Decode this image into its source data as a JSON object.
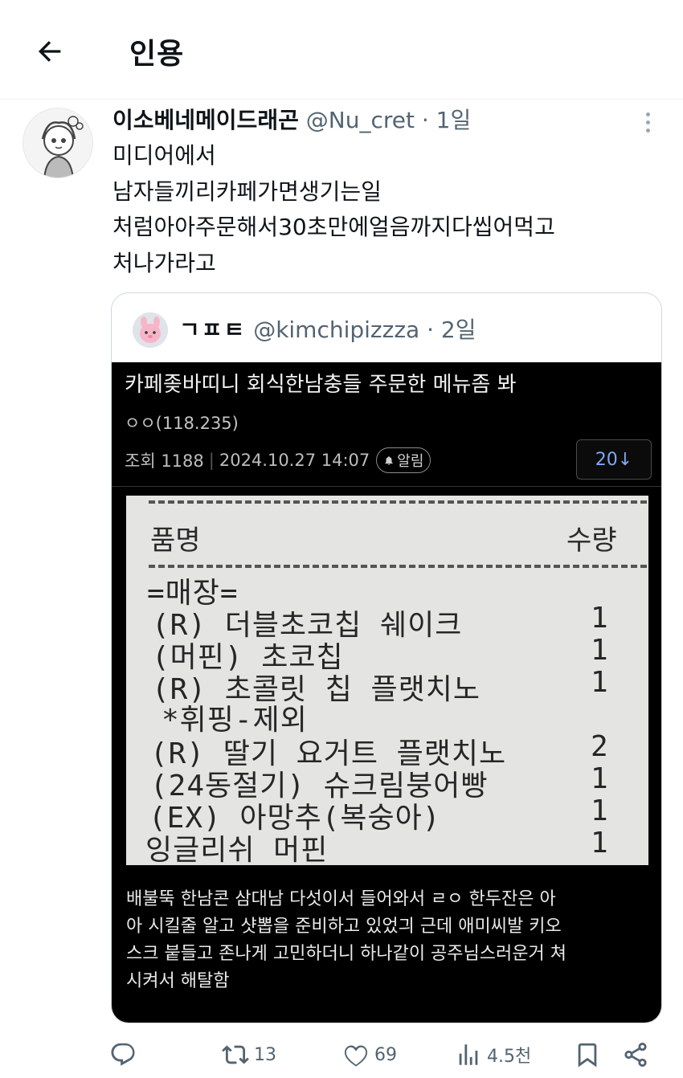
{
  "header": {
    "title": "인용"
  },
  "tweet": {
    "author_name": "이소베네메이드래곤",
    "handle": "@Nu_cret",
    "time": "1일",
    "lines": [
      "미디어에서",
      "남자들끼리카페가면생기는일",
      "처럼아아주문해서30초만에얼음까지다씹어먹고",
      "처나가라고"
    ]
  },
  "quote": {
    "author_name": "ㄱㅍㅌ",
    "handle": "@kimchipizzza",
    "time": "2일",
    "post": {
      "title": "카페좆바띠니 회식한남충들 주문한 메뉴좀 봐",
      "author": "ㅇㅇ(118.235)",
      "views_label": "조회 1188",
      "date": "2024.10.27 14:07",
      "alarm": "알림",
      "page_button": "20↓"
    },
    "receipt": {
      "col_item": "품명",
      "col_qty": "수량",
      "section": "=매장=",
      "items": [
        {
          "name": "(R) 더블초코칩 쉐이크",
          "qty": "1"
        },
        {
          "name": "(머핀) 초코칩",
          "qty": "1"
        },
        {
          "name": "(R) 초콜릿 칩 플랫치노",
          "qty": "1"
        },
        {
          "name": " *휘핑-제외",
          "qty": ""
        },
        {
          "name": "(R) 딸기 요거트 플랫치노",
          "qty": "2"
        },
        {
          "name": "(24동절기) 슈크림붕어빵",
          "qty": "1"
        },
        {
          "name": "(EX) 아망추(복숭아)",
          "qty": "1"
        },
        {
          "name": "잉글리쉬 머핀",
          "qty": "1"
        }
      ]
    },
    "caption_lines": [
      "배불뚝 한남콘 삼대남 다섯이서 들어와서 ㄹㅇ 한두잔은 아",
      "아 시킬줄 알고 샷뽑을 준비하고 있었긔 근데 애미씨발 키오",
      "스크 붙들고 존나게 고민하더니 하나같이 공주님스러운거 쳐",
      "시켜서 해탈함"
    ]
  },
  "actions": {
    "retweets": "13",
    "likes": "69",
    "views": "4.5천"
  }
}
